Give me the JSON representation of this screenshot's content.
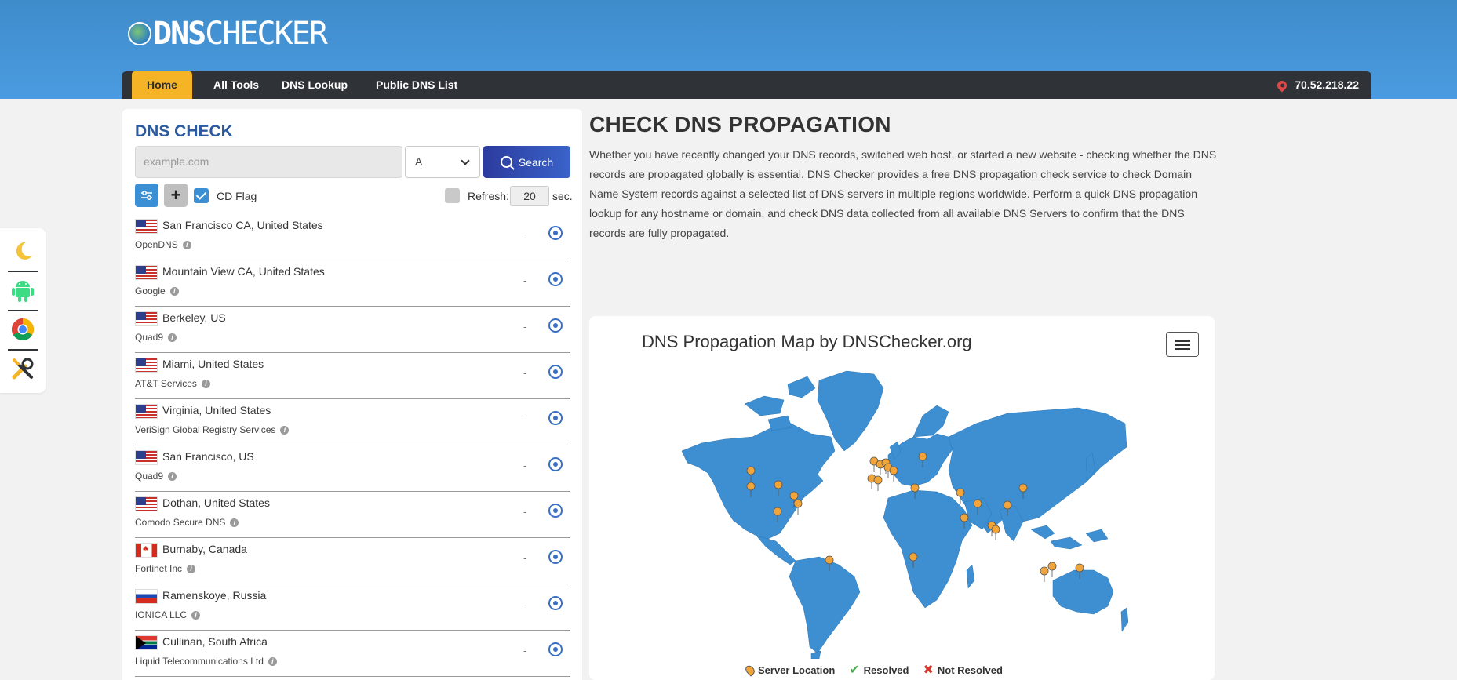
{
  "header": {
    "logo_dns": "DNS",
    "logo_checker": "CHECKER"
  },
  "nav": {
    "items": [
      "Home",
      "All Tools",
      "DNS Lookup",
      "Public DNS List"
    ],
    "ip": "70.52.218.22"
  },
  "tools": [
    "moon-icon",
    "android-icon",
    "chrome-icon",
    "tools-icon"
  ],
  "check": {
    "title": "DNS CHECK",
    "placeholder": "example.com",
    "record_type": "A",
    "search_label": "Search",
    "cd_flag_label": "CD Flag",
    "refresh_label": "Refresh:",
    "refresh_value": "20",
    "refresh_unit": "sec."
  },
  "servers": [
    {
      "location": "San Francisco CA, United States",
      "provider": "OpenDNS",
      "flag": "us",
      "result": "-"
    },
    {
      "location": "Mountain View CA, United States",
      "provider": "Google",
      "flag": "us",
      "result": "-"
    },
    {
      "location": "Berkeley, US",
      "provider": "Quad9",
      "flag": "us",
      "result": "-"
    },
    {
      "location": "Miami, United States",
      "provider": "AT&T Services",
      "flag": "us",
      "result": "-"
    },
    {
      "location": "Virginia, United States",
      "provider": "VeriSign Global Registry Services",
      "flag": "us",
      "result": "-"
    },
    {
      "location": "San Francisco, US",
      "provider": "Quad9",
      "flag": "us",
      "result": "-"
    },
    {
      "location": "Dothan, United States",
      "provider": "Comodo Secure DNS",
      "flag": "us",
      "result": "-"
    },
    {
      "location": "Burnaby, Canada",
      "provider": "Fortinet Inc",
      "flag": "ca",
      "result": "-"
    },
    {
      "location": "Ramenskoye, Russia",
      "provider": "IONICA LLC",
      "flag": "ru",
      "result": "-"
    },
    {
      "location": "Cullinan, South Africa",
      "provider": "Liquid Telecommunications Ltd",
      "flag": "za",
      "result": "-"
    }
  ],
  "main": {
    "title": "CHECK DNS PROPAGATION",
    "description": "Whether you have recently changed your DNS records, switched web host, or started a new website - checking whether the DNS records are propagated globally is essential. DNS Checker provides a free DNS propagation check service to check Domain Name System records against a selected list of DNS servers in multiple regions worldwide. Perform a quick DNS propagation lookup for any hostname or domain, and check DNS data collected from all available DNS Servers to confirm that the DNS records are fully propagated."
  },
  "map": {
    "title": "DNS Propagation Map by DNSChecker.org",
    "legend": [
      "Server Location",
      "Resolved",
      "Not Resolved"
    ],
    "colors": {
      "land": "#3d8fd1",
      "pin": "#f0a43a"
    }
  }
}
